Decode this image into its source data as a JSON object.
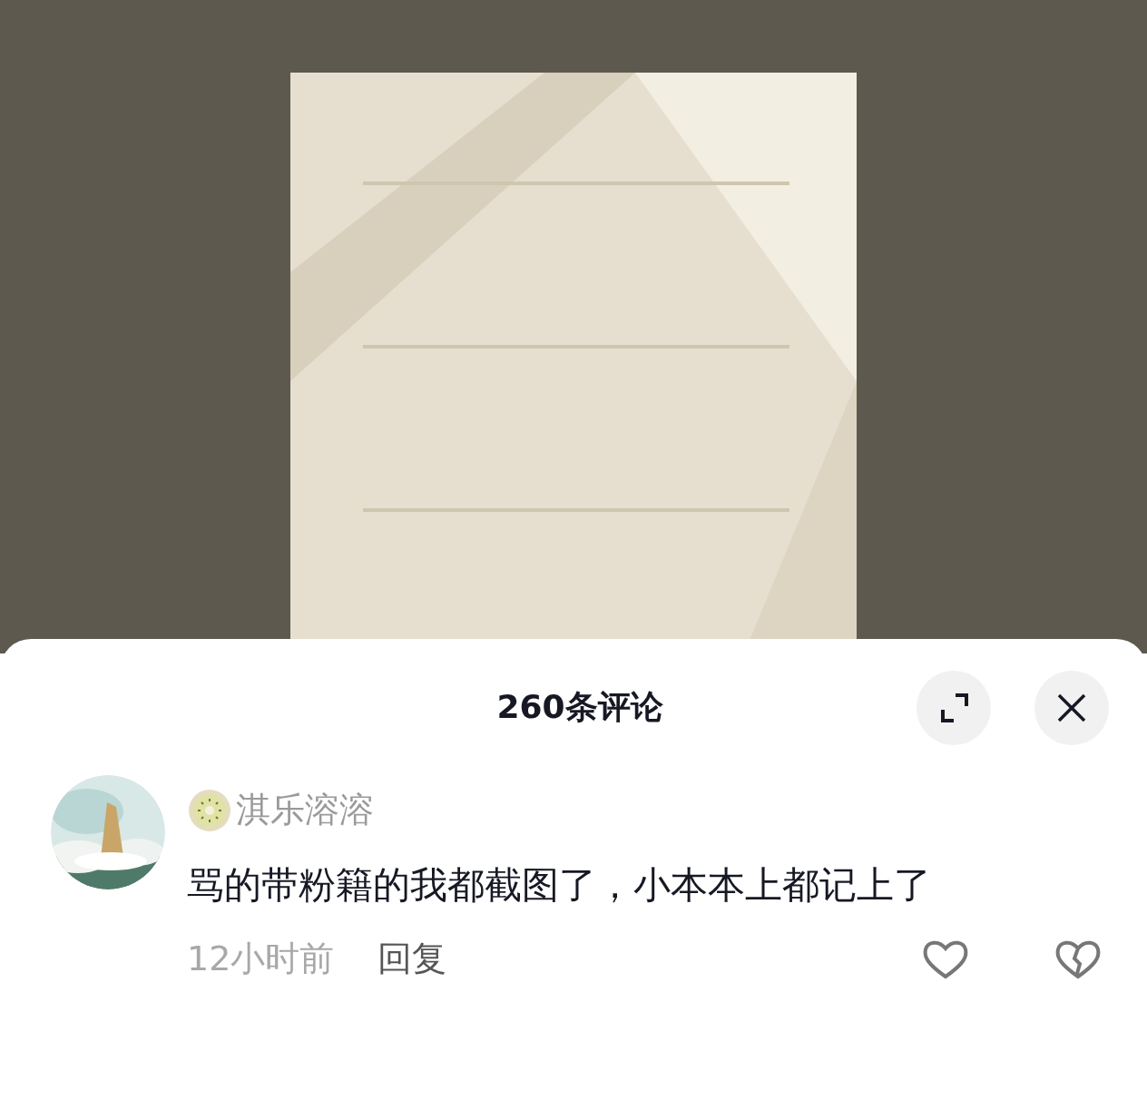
{
  "comments_panel": {
    "title": "260条评论",
    "comments": [
      {
        "username": "淇乐溶溶",
        "text": "骂的带粉籍的我都截图了，小本本上都记上了",
        "time": "12小时前",
        "reply": "回复"
      }
    ]
  }
}
